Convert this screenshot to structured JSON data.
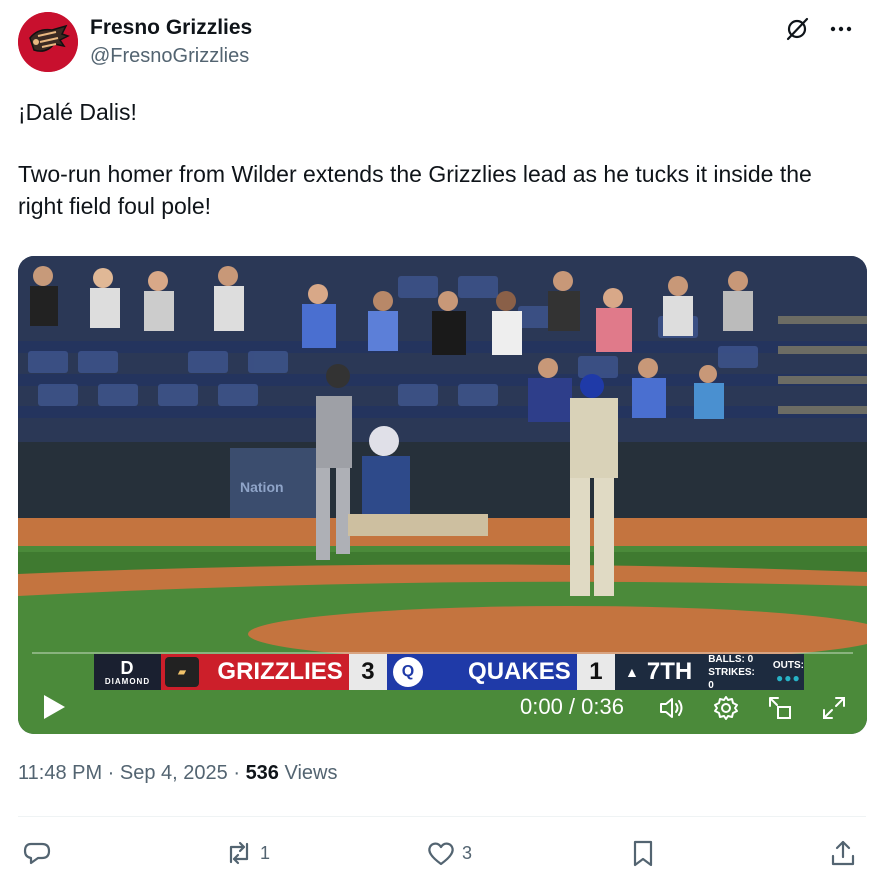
{
  "author": {
    "display_name": "Fresno Grizzlies",
    "handle": "@FresnoGrizzlies",
    "avatar_icon": "grizzly-claw-logo",
    "brand_color": "#c8102e"
  },
  "header_icons": [
    "grok-icon",
    "more-icon"
  ],
  "tweet": {
    "line1": "¡Dalé Dalis!",
    "line2": "Two-run homer from Wilder extends the Grizzlies lead as he tucks it inside the right field foul pole!"
  },
  "video": {
    "scorebug": {
      "network_big": "D",
      "network_small": "DIAMOND",
      "home_team": "GRIZZLIES",
      "home_score": "3",
      "away_team": "QUAKES",
      "away_score": "1",
      "inning": "7TH",
      "balls": "BALLS: 0",
      "strikes": "STRIKES: 0",
      "outs_label": "OUTS:",
      "outs_dots": "●●●"
    },
    "time_display": "0:00 / 0:36",
    "progress_fraction": 0,
    "controls": [
      "play-icon",
      "volume-icon",
      "settings-icon",
      "pip-icon",
      "fullscreen-icon"
    ]
  },
  "meta": {
    "time": "11:48 PM",
    "sep1": " · ",
    "date": "Sep 4, 2025",
    "sep2": " · ",
    "views_count": "536",
    "views_label": " Views"
  },
  "actions": {
    "reply_count": "",
    "repost_count": "1",
    "like_count": "3"
  }
}
